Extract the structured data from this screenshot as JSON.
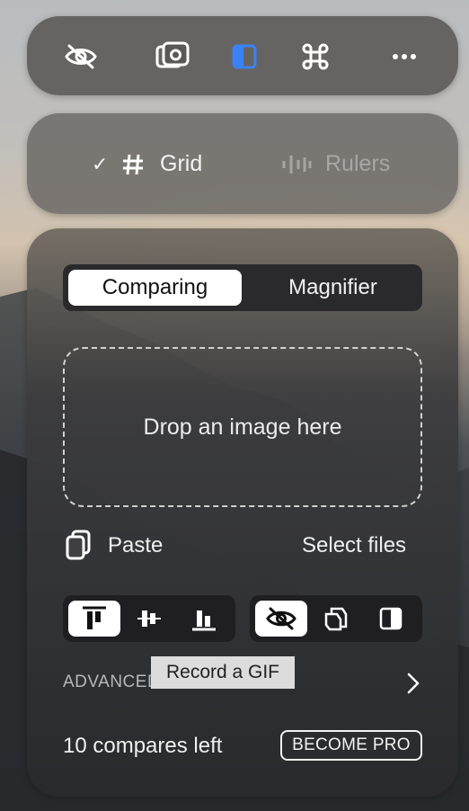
{
  "toolbar": {
    "icons": [
      "eye-off-icon",
      "screenshot-camera-icon",
      "sidebar-panel-icon",
      "command-key-icon",
      "more-icon"
    ],
    "accent": "#3b82f6"
  },
  "guides": {
    "grid_check": "✓",
    "grid_label": "Grid",
    "rulers_label": "Rulers"
  },
  "mode": {
    "tabs": [
      "Comparing",
      "Magnifier"
    ],
    "active": "Comparing"
  },
  "dropzone": {
    "text": "Drop an image here"
  },
  "actions": {
    "paste_label": "Paste",
    "select_label": "Select files"
  },
  "align_group": [
    "align-top-icon",
    "align-center-icon",
    "align-bottom-icon"
  ],
  "view_group": [
    "eye-off-icon",
    "layers-icon",
    "split-view-icon"
  ],
  "advanced": {
    "label": "ADVANCED",
    "tooltip": "Record a GIF"
  },
  "footer": {
    "compares_left": "10 compares left",
    "pro_button": "BECOME PRO"
  }
}
